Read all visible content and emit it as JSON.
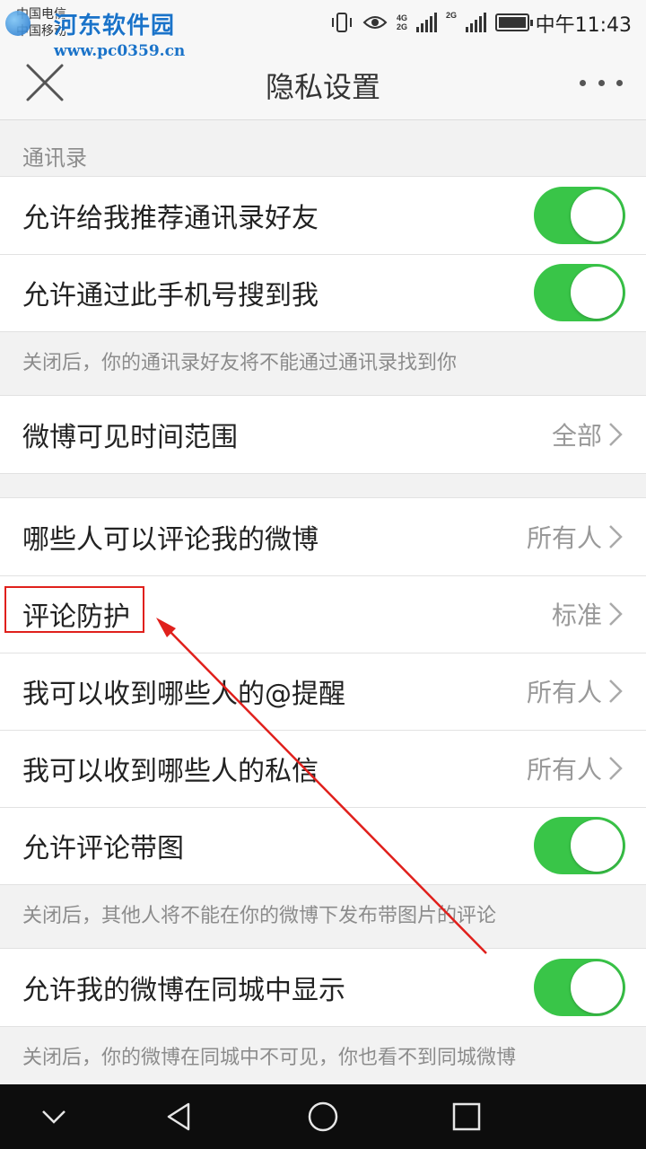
{
  "status_bar": {
    "carrier_1": "中国电信",
    "carrier_2": "中国移动",
    "time": "中午11:43",
    "net_1": "4G",
    "net_2": "2G",
    "net_3": "2G"
  },
  "watermark": {
    "title": "河东软件园",
    "url": "www.pc0359.cn"
  },
  "header": {
    "title": "隐私设置",
    "close_icon": "close-icon",
    "more_icon": "more-icon"
  },
  "sections": {
    "contacts_label": "通讯录",
    "contacts": {
      "recommend_label": "允许给我推荐通讯录好友",
      "recommend_on": true,
      "phone_search_label": "允许通过此手机号搜到我",
      "phone_search_on": true,
      "note": "关闭后，你的通讯录好友将不能通过通讯录找到你"
    },
    "visibility": {
      "label": "微博可见时间范围",
      "value": "全部"
    },
    "interaction": {
      "comment_who_label": "哪些人可以评论我的微博",
      "comment_who_value": "所有人",
      "comment_protect_label": "评论防护",
      "comment_protect_value": "标准",
      "mention_label": "我可以收到哪些人的@提醒",
      "mention_value": "所有人",
      "dm_label": "我可以收到哪些人的私信",
      "dm_value": "所有人",
      "comment_image_label": "允许评论带图",
      "comment_image_on": true,
      "comment_image_note": "关闭后，其他人将不能在你的微博下发布带图片的评论"
    },
    "local": {
      "label": "允许我的微博在同城中显示",
      "on": true,
      "note": "关闭后，你的微博在同城中不可见，你也看不到同城微博"
    }
  },
  "colors": {
    "toggle_on": "#39c548",
    "annotation": "#e0201c",
    "navbar": "#0d0d0d"
  }
}
